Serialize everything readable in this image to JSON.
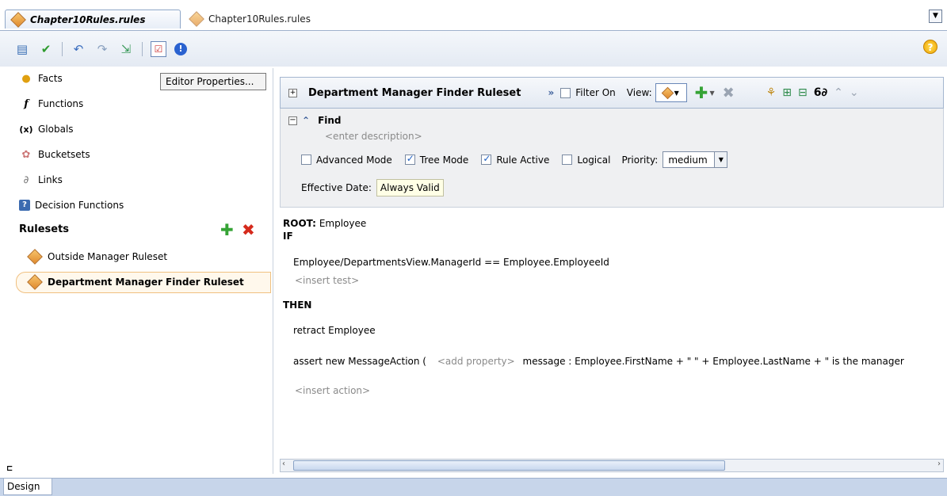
{
  "tabs": [
    {
      "label": "Chapter10Rules.rules",
      "active": true
    },
    {
      "label": "Chapter10Rules.rules",
      "active": false
    }
  ],
  "toolbar": {
    "icons": [
      "book-icon",
      "check-icon",
      "undo-icon",
      "redo-icon",
      "import-icon",
      "editor-properties-icon",
      "info-icon"
    ]
  },
  "tooltip": "Editor Properties...",
  "nav": {
    "items": [
      {
        "label": "Facts",
        "icon": "facts-icon"
      },
      {
        "label": "Functions",
        "icon": "function-icon"
      },
      {
        "label": "Globals",
        "icon": "globals-icon"
      },
      {
        "label": "Bucketsets",
        "icon": "bucketsets-icon"
      },
      {
        "label": "Links",
        "icon": "links-icon"
      },
      {
        "label": "Decision Functions",
        "icon": "decision-functions-icon"
      }
    ],
    "rulesets_label": "Rulesets",
    "rulesets": [
      {
        "label": "Outside Manager Ruleset",
        "selected": false
      },
      {
        "label": "Department Manager Finder Ruleset",
        "selected": true
      }
    ]
  },
  "ruleset_header": {
    "title": "Department Manager Finder Ruleset",
    "filter_label": "Filter On",
    "view_label": "View:"
  },
  "rule": {
    "name": "Find",
    "description_placeholder": "<enter description>",
    "options": {
      "advanced_mode": {
        "label": "Advanced Mode",
        "checked": false
      },
      "tree_mode": {
        "label": "Tree Mode",
        "checked": true
      },
      "rule_active": {
        "label": "Rule Active",
        "checked": true
      },
      "logical": {
        "label": "Logical",
        "checked": false
      }
    },
    "priority_label": "Priority:",
    "priority_value": "medium",
    "effective_date_label": "Effective Date:",
    "effective_date_value": "Always Valid"
  },
  "code": {
    "root_keyword": "ROOT:",
    "root_value": "Employee",
    "if_keyword": "IF",
    "test": "Employee/DepartmentsView.ManagerId  ==  Employee.EmployeeId",
    "insert_test": "<insert test>",
    "then_keyword": "THEN",
    "action1": "retract Employee",
    "action2_prefix": "assert new MessageAction (",
    "add_property": "<add property>",
    "action2_suffix": "message : Employee.FirstName + \" \" + Employee.LastName + \" is the manager",
    "insert_action": "<insert action>"
  },
  "footer": {
    "design_tab": "Design"
  },
  "colors": {
    "accent": "#c7d5ea",
    "add": "#35a335",
    "delete": "#d52a1c"
  }
}
